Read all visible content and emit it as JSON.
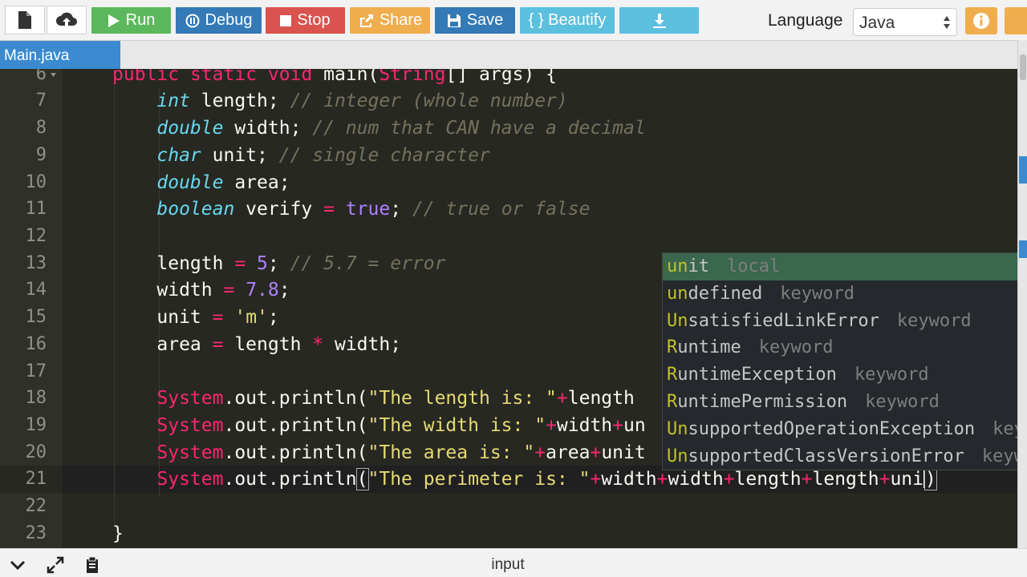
{
  "toolbar": {
    "buttons": [
      {
        "label": "Run",
        "color": "#5cb85c"
      },
      {
        "label": "Debug",
        "color": "#337ab7"
      },
      {
        "label": "Stop",
        "color": "#d9534f"
      },
      {
        "label": "Share",
        "color": "#f0ad4e"
      },
      {
        "label": "Save",
        "color": "#337ab7"
      },
      {
        "label": "{ } Beautify",
        "color": "#5bc0de"
      }
    ],
    "language_label": "Language",
    "language_value": "Java"
  },
  "tabs": [
    {
      "label": "Main.java"
    }
  ],
  "editor": {
    "lines": [
      {
        "n": "6"
      },
      {
        "n": "7"
      },
      {
        "n": "8"
      },
      {
        "n": "9"
      },
      {
        "n": "10"
      },
      {
        "n": "11"
      },
      {
        "n": "12"
      },
      {
        "n": "13"
      },
      {
        "n": "14"
      },
      {
        "n": "15"
      },
      {
        "n": "16"
      },
      {
        "n": "17"
      },
      {
        "n": "18"
      },
      {
        "n": "19"
      },
      {
        "n": "20"
      },
      {
        "n": "21"
      },
      {
        "n": "22"
      },
      {
        "n": "23"
      }
    ],
    "active_line": "21"
  },
  "autocomplete": {
    "items": [
      {
        "match": "un",
        "rest": "it",
        "meta": "local"
      },
      {
        "match": "un",
        "rest": "defined",
        "meta": "keyword"
      },
      {
        "match": "Un",
        "rest": "satisfiedLinkError",
        "meta": "keyword"
      },
      {
        "match": "R",
        "rest": "untime",
        "meta": "keyword"
      },
      {
        "match": "R",
        "rest": "untimeException",
        "meta": "keyword"
      },
      {
        "match": "R",
        "rest": "untimePermission",
        "meta": "keyword"
      },
      {
        "match": "Un",
        "rest": "supportedOperationException",
        "meta": "keyword"
      },
      {
        "match": "Un",
        "rest": "supportedClassVersionError",
        "meta": "keyword"
      }
    ]
  },
  "bottom_bar": {
    "title": "input"
  }
}
